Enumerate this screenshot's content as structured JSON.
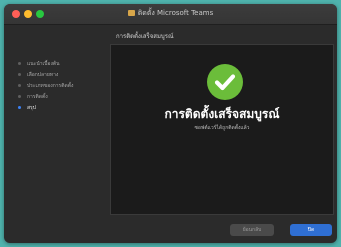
{
  "window": {
    "title": "ติดตั้ง Microsoft Teams"
  },
  "sidebar": {
    "steps": [
      {
        "label": "แนะนำเบื้องต้น",
        "active": false
      },
      {
        "label": "เลือกปลายทาง",
        "active": false
      },
      {
        "label": "ประเภทของการติดตั้ง",
        "active": false
      },
      {
        "label": "การติดตั้ง",
        "active": false
      },
      {
        "label": "สรุป",
        "active": true
      }
    ]
  },
  "main": {
    "heading": "การติดตั้งเสร็จสมบูรณ์",
    "status_title": "การติดตั้งเสร็จสมบูรณ์",
    "status_subtitle": "ซอฟต์แวร์ได้ถูกติดตั้งแล้ว"
  },
  "footer": {
    "back_label": "ย้อนกลับ",
    "close_label": "ปิด"
  },
  "colors": {
    "desktop": "#4fb3ad",
    "accent": "#2f6fd3",
    "success": "#6bbd3a"
  }
}
